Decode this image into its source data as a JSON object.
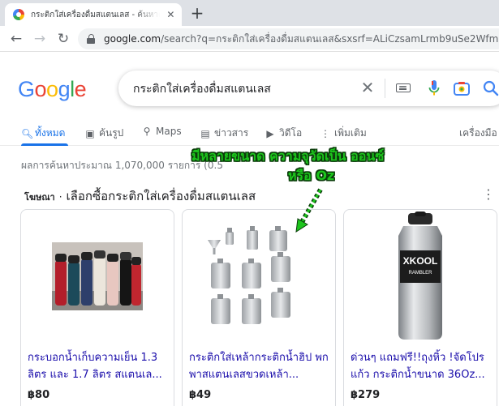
{
  "browser": {
    "tab_title": "กระติกใส่เครื่องดื่มสแตนเลส - ค้นหาด้วย Google",
    "new_tab": "+",
    "url_host": "google.com",
    "url_path": "/search?q=กระติกใส่เครื่องดื่มสแตนเลส&sxsrf=ALiCzsamLrmb9uSe2WfmRWRPm"
  },
  "google": {
    "logo_letters": [
      "G",
      "o",
      "o",
      "g",
      "l",
      "e"
    ],
    "search_query": "กระติกใส่เครื่องดื่มสแตนเลส",
    "tabs": [
      {
        "label": "ทั้งหมด",
        "icon": "search-icon",
        "active": true
      },
      {
        "label": "ค้นรูป",
        "icon": "image-icon",
        "active": false
      },
      {
        "label": "Maps",
        "icon": "map-pin-icon",
        "active": false
      },
      {
        "label": "ข่าวสาร",
        "icon": "news-icon",
        "active": false
      },
      {
        "label": "วิดีโอ",
        "icon": "video-icon",
        "active": false
      },
      {
        "label": "เพิ่มเติม",
        "icon": "more-vert-icon",
        "active": false
      },
      {
        "label": "เครื่องมือ",
        "icon": "",
        "active": false
      }
    ],
    "result_stats": "ผลการค้นหาประมาณ 1,070,000 รายการ (0.5",
    "ads": {
      "tag": "โฆษณา",
      "dot": "·",
      "title": "เลือกซื้อกระติกใส่เครื่องดื่มสแตนเลส"
    },
    "products": [
      {
        "title": "กระบอกน้ำเก็บความเย็น 1.3 ลิตร และ 1.7 ลิตร สแตนเล...",
        "price": "฿80"
      },
      {
        "title": "กระติกใส่เหล้ากระติกน้ำฮิป พกพาสแตนเลสขวดเหล้า...",
        "price": "฿49"
      },
      {
        "title": "ด่วนๆ แถมฟรี!!ถุงหิ้ว !จัดโปร แก้ว กระติกน้ำขนาด 36Oz...",
        "price": "฿279",
        "image_brand": "XKOOL",
        "image_sub": "RAMBLER"
      }
    ]
  },
  "annotation": {
    "line1": "มีหลายขนาด ความจุวัดเป็น ออนซ์",
    "line2": "หรือ Oz",
    "color": "#1cc41c"
  },
  "colors": {
    "link": "#1a0dab",
    "active_tab": "#1a73e8",
    "chrome_bg": "#dee1e6"
  }
}
